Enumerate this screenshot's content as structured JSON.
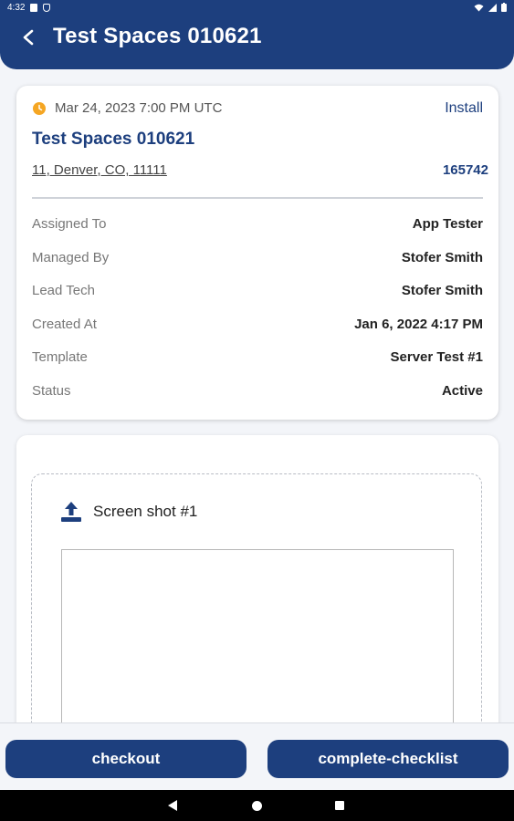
{
  "status_bar": {
    "time": "4:32",
    "icons": [
      "notification-icon",
      "shield-icon",
      "wifi-icon",
      "signal-icon",
      "battery-icon"
    ]
  },
  "header": {
    "title": "Test Spaces 010621",
    "back_icon": "chevron-left-icon"
  },
  "job": {
    "datetime": "Mar 24, 2023 7:00 PM UTC",
    "type": "Install",
    "title": "Test Spaces 010621",
    "address": "11, Denver, CO, 11111",
    "number": "165742",
    "details": [
      {
        "label": "Assigned To",
        "value": "App Tester"
      },
      {
        "label": "Managed By",
        "value": "Stofer Smith"
      },
      {
        "label": "Lead Tech",
        "value": "Stofer Smith"
      },
      {
        "label": "Created At",
        "value": "Jan 6, 2022 4:17 PM"
      },
      {
        "label": "Template",
        "value": "Server Test #1"
      },
      {
        "label": "Status",
        "value": "Active"
      }
    ]
  },
  "checklist": {
    "item_label": "Screen shot #1",
    "upload_icon": "upload-icon"
  },
  "actions": {
    "checkout_label": "checkout",
    "complete_label": "complete-checklist"
  },
  "colors": {
    "primary": "#1d3f7e",
    "accent_clock": "#f5a623",
    "background": "#f3f5f9"
  }
}
